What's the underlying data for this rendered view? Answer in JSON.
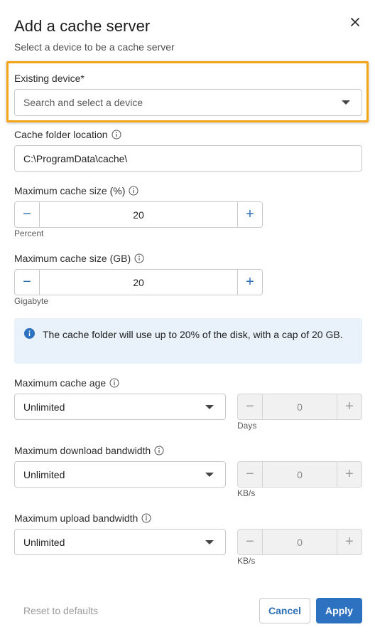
{
  "dialog": {
    "title": "Add a cache server",
    "subtitle": "Select a device to be a cache server"
  },
  "device": {
    "label": "Existing device*",
    "placeholder": "Search and select a device"
  },
  "folder": {
    "label": "Cache folder location",
    "value": "C:\\ProgramData\\cache\\"
  },
  "size_percent": {
    "label": "Maximum cache size (%)",
    "value": "20",
    "unit": "Percent"
  },
  "size_gb": {
    "label": "Maximum cache size (GB)",
    "value": "20",
    "unit": "Gigabyte"
  },
  "info_banner": {
    "text": "The cache folder will use up to 20% of the disk, with a cap of 20 GB."
  },
  "cache_age": {
    "label": "Maximum cache age",
    "selected": "Unlimited",
    "value": "0",
    "unit": "Days"
  },
  "download_bw": {
    "label": "Maximum download bandwidth",
    "selected": "Unlimited",
    "value": "0",
    "unit": "KB/s"
  },
  "upload_bw": {
    "label": "Maximum upload bandwidth",
    "selected": "Unlimited",
    "value": "0",
    "unit": "KB/s"
  },
  "footer": {
    "reset_label": "Reset to defaults",
    "cancel_label": "Cancel",
    "apply_label": "Apply"
  },
  "icons": {
    "minus": "−",
    "plus": "+"
  },
  "colors": {
    "accent": "#2c72c0",
    "highlight": "#f2a516",
    "banner_bg": "#e9f2fb"
  }
}
